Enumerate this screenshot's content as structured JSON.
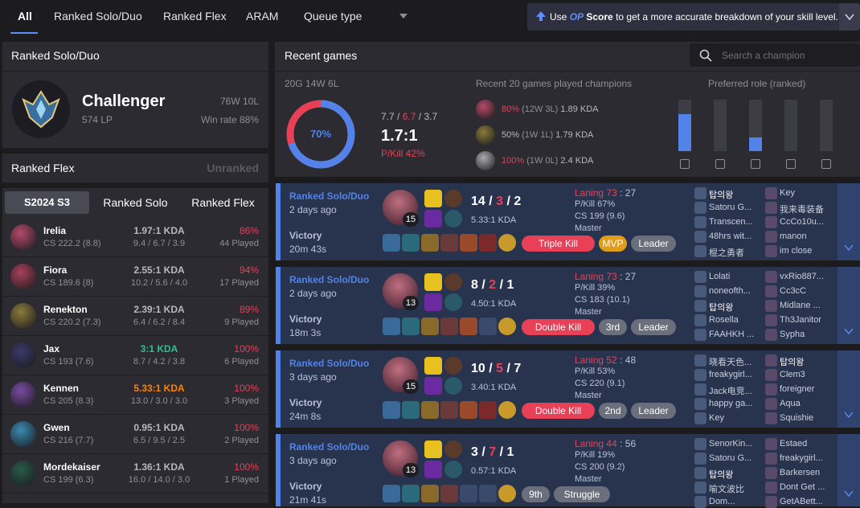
{
  "tabs": [
    {
      "label": "All"
    },
    {
      "label": "Ranked Solo/Duo"
    },
    {
      "label": "Ranked Flex"
    },
    {
      "label": "ARAM"
    },
    {
      "label": "Queue type"
    }
  ],
  "banner": {
    "pre": "Use",
    "brand": "OP",
    "score": "Score",
    "post": "to get a more accurate breakdown of your skill level."
  },
  "solo": {
    "title": "Ranked Solo/Duo",
    "tier": "Challenger",
    "lp": "574 LP",
    "record": "76W 10L",
    "winrate": "Win rate 88%"
  },
  "flex": {
    "title": "Ranked Flex",
    "status": "Unranked"
  },
  "season_tabs": [
    {
      "label": "S2024 S3"
    },
    {
      "label": "Ranked Solo"
    },
    {
      "label": "Ranked Flex"
    }
  ],
  "champions": [
    {
      "name": "Irelia",
      "cs": "CS 222.2 (8.8)",
      "kda": "1.97:1 KDA",
      "kda_detail": "9.4 / 6.7 / 3.9",
      "wr": "86%",
      "played": "44 Played",
      "color": "#b54a6a",
      "kda_class": ""
    },
    {
      "name": "Fiora",
      "cs": "CS 189.6 (8)",
      "kda": "2.55:1 KDA",
      "kda_detail": "10.2 / 5.6 / 4.0",
      "wr": "94%",
      "played": "17 Played",
      "color": "#a8405a",
      "kda_class": ""
    },
    {
      "name": "Renekton",
      "cs": "CS 220.2 (7.3)",
      "kda": "2.39:1 KDA",
      "kda_detail": "6.4 / 6.2 / 8.4",
      "wr": "89%",
      "played": "9 Played",
      "color": "#8a7a3a",
      "kda_class": ""
    },
    {
      "name": "Jax",
      "cs": "CS 193 (7.6)",
      "kda": "3:1 KDA",
      "kda_detail": "8.7 / 4.2 / 3.8",
      "wr": "100%",
      "played": "6 Played",
      "color": "#3a3a6a",
      "kda_class": "green"
    },
    {
      "name": "Kennen",
      "cs": "CS 205 (8.3)",
      "kda": "5.33:1 KDA",
      "kda_detail": "13.0 / 3.0 / 3.0",
      "wr": "100%",
      "played": "3 Played",
      "color": "#7a4aa0",
      "kda_class": "orange"
    },
    {
      "name": "Gwen",
      "cs": "CS 216 (7.7)",
      "kda": "0.95:1 KDA",
      "kda_detail": "6.5 / 9.5 / 2.5",
      "wr": "100%",
      "played": "2 Played",
      "color": "#3a8ab0",
      "kda_class": ""
    },
    {
      "name": "Mordekaiser",
      "cs": "CS 199 (6.3)",
      "kda": "1.36:1 KDA",
      "kda_detail": "16.0 / 14.0 / 3.0",
      "wr": "100%",
      "played": "1 Played",
      "color": "#2a5a4a",
      "kda_class": ""
    }
  ],
  "recent": {
    "title": "Recent games",
    "search_placeholder": "Search a champion",
    "summary": "20G 14W 6L",
    "winrate_pct": 70,
    "winrate_label": "70%",
    "avg_k": "7.7",
    "avg_d": "6.7",
    "avg_a": "3.7",
    "sep": "/",
    "kda_ratio": "1.7:1",
    "pkill": "P/Kill 42%",
    "champs_title": "Recent 20 games played champions",
    "recent_champs": [
      {
        "wr": "80%",
        "rec": "(12W 3L)",
        "kda": "1.89 KDA",
        "color": "#b54a6a"
      },
      {
        "wr": "50%",
        "rec": "(1W 1L)",
        "kda": "1.79 KDA",
        "color": "#8a7a3a"
      },
      {
        "wr": "100%",
        "rec": "(1W 0L)",
        "kda": "2.4 KDA",
        "color": "#aaaaaa"
      }
    ],
    "role_title": "Preferred role (ranked)",
    "roles": [
      {
        "name": "top",
        "share": 0.72
      },
      {
        "name": "jungle",
        "share": 0
      },
      {
        "name": "mid",
        "share": 0.26
      },
      {
        "name": "adc",
        "share": 0
      },
      {
        "name": "support",
        "share": 0
      }
    ]
  },
  "games": [
    {
      "queue": "Ranked Solo/Duo",
      "ago": "2 days ago",
      "result": "Victory",
      "duration": "20m 43s",
      "level": "15",
      "k": "14",
      "d": "3",
      "a": "2",
      "kda": "5.33:1 KDA",
      "laning_label": "Laning",
      "laning_a": "73",
      "laning_b": "27",
      "pkill": "P/Kill 67%",
      "cs": "CS 199 (9.6)",
      "rank": "Master",
      "badges": [
        {
          "text": "Triple Kill",
          "cls": "b-red"
        },
        {
          "text": "MVP",
          "cls": "b-gold"
        },
        {
          "text": "Leader",
          "cls": "b-gray"
        }
      ],
      "team1": [
        "탑의왕",
        "Satoru G...",
        "Transcen...",
        "48hrs wit...",
        "棍之勇者"
      ],
      "team2": [
        "Key",
        "我来毒装备",
        "CcCo10u...",
        "manon",
        "im close"
      ],
      "me1": 0,
      "me2": -1
    },
    {
      "queue": "Ranked Solo/Duo",
      "ago": "2 days ago",
      "result": "Victory",
      "duration": "18m 3s",
      "level": "13",
      "k": "8",
      "d": "2",
      "a": "1",
      "kda": "4.50:1 KDA",
      "laning_label": "Laning",
      "laning_a": "73",
      "laning_b": "27",
      "pkill": "P/Kill 39%",
      "cs": "CS 183 (10.1)",
      "rank": "Master",
      "badges": [
        {
          "text": "Double Kill",
          "cls": "b-red"
        },
        {
          "text": "3rd",
          "cls": "b-gray"
        },
        {
          "text": "Leader",
          "cls": "b-gray"
        }
      ],
      "team1": [
        "Lolati",
        "noneofth...",
        "탑의왕",
        "Rosella",
        "FAAHKH ..."
      ],
      "team2": [
        "vxRio887...",
        "Cc3cC",
        "Midlane ...",
        "Th3Janitor",
        "Sypha"
      ],
      "me1": 2,
      "me2": -1
    },
    {
      "queue": "Ranked Solo/Duo",
      "ago": "3 days ago",
      "result": "Victory",
      "duration": "24m 8s",
      "level": "15",
      "k": "10",
      "d": "5",
      "a": "7",
      "kda": "3.40:1 KDA",
      "laning_label": "Laning",
      "laning_a": "52",
      "laning_b": "48",
      "pkill": "P/Kill 53%",
      "cs": "CS 220 (9.1)",
      "rank": "Master",
      "badges": [
        {
          "text": "Double Kill",
          "cls": "b-red"
        },
        {
          "text": "2nd",
          "cls": "b-gray"
        },
        {
          "text": "Leader",
          "cls": "b-gray"
        }
      ],
      "team1": [
        "晓看天色...",
        "freakygirl...",
        "Jack电竞...",
        "happy ga...",
        "Key"
      ],
      "team2": [
        "탑의왕",
        "Clem3",
        "foreigner",
        "Aqua",
        "Squishie"
      ],
      "me1": -1,
      "me2": 0
    },
    {
      "queue": "Ranked Solo/Duo",
      "ago": "3 days ago",
      "result": "Victory",
      "duration": "21m 41s",
      "level": "13",
      "k": "3",
      "d": "7",
      "a": "1",
      "kda": "0.57:1 KDA",
      "laning_label": "Laning",
      "laning_a": "44",
      "laning_b": "56",
      "pkill": "P/Kill 19%",
      "cs": "CS 200 (9.2)",
      "rank": "Master",
      "badges": [
        {
          "text": "9th",
          "cls": "b-gray"
        },
        {
          "text": "Struggle",
          "cls": "b-gray"
        }
      ],
      "team1": [
        "SenorKin...",
        "Satoru G...",
        "탑의왕",
        "喻文波比",
        "Dom..."
      ],
      "team2": [
        "Estaed",
        "freakygirl...",
        "Barkersen",
        "Dont Get ...",
        "GetABett..."
      ],
      "me1": 2,
      "me2": -1
    }
  ]
}
